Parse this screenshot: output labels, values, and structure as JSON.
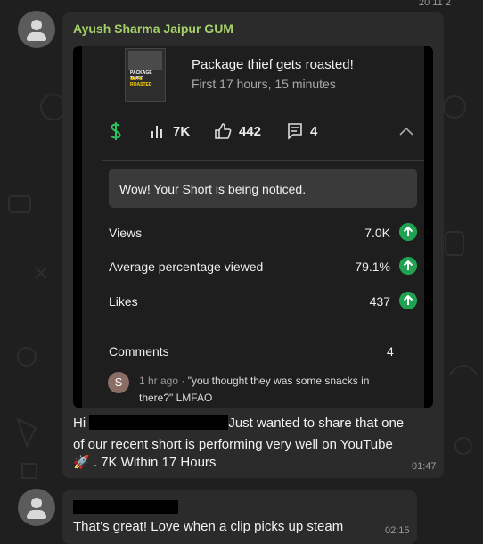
{
  "top_clip": "20 11 2",
  "message1": {
    "sender": "Ayush Sharma Jaipur GUM",
    "card": {
      "thumb_line1": "PACKAGE THIEF",
      "thumb_line2": "GETS ROASTED",
      "video_title": "Package thief gets roasted!",
      "video_subtitle": "First 17 hours, 15 minutes",
      "stats": {
        "views": "7K",
        "likes": "442",
        "comments": "4"
      },
      "notice": "Wow! Your Short is being noticed.",
      "metrics": [
        {
          "label": "Views",
          "value": "7.0K"
        },
        {
          "label": "Average percentage viewed",
          "value": "79.1%"
        },
        {
          "label": "Likes",
          "value": "437"
        }
      ],
      "comments_label": "Comments",
      "comments_count": "4",
      "comment": {
        "initial": "S",
        "time": "1 hr ago · ",
        "text": "\"you thought they was some snacks in there?\" LMFAO"
      }
    },
    "text_hi": "Hi",
    "text_rest": "Just wanted to share that one",
    "text_line2": "of our recent short is performing very well on YouTube",
    "text_line3": "🚀 . 7K Within 17 Hours",
    "time": "01:47"
  },
  "message2": {
    "text": "That’s great! Love when a clip picks up steam",
    "time": "02:15"
  },
  "colors": {
    "accent_green": "#21a152",
    "sender_green": "#a5d16a",
    "dollar_green": "#2fbf5f"
  }
}
